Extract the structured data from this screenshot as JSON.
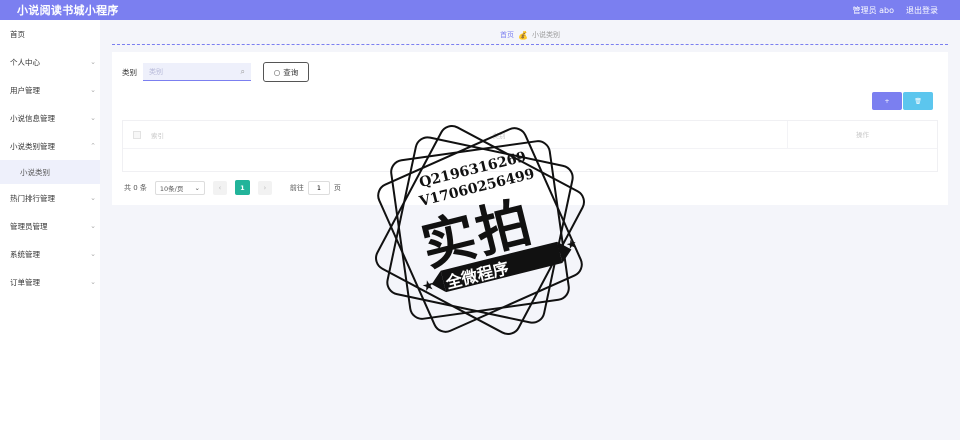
{
  "header": {
    "app_title": "小说阅读书城小程序",
    "admin_label": "管理员 abo",
    "logout_label": "退出登录"
  },
  "sidebar": {
    "items": [
      {
        "label": "首页",
        "has_arrow": false
      },
      {
        "label": "个人中心",
        "has_arrow": true
      },
      {
        "label": "用户管理",
        "has_arrow": true
      },
      {
        "label": "小说信息管理",
        "has_arrow": true
      },
      {
        "label": "小说类别管理",
        "has_arrow": true
      },
      {
        "label": "小说类别",
        "sub": true
      },
      {
        "label": "热门排行管理",
        "has_arrow": true
      },
      {
        "label": "管理员管理",
        "has_arrow": true
      },
      {
        "label": "系统管理",
        "has_arrow": true
      },
      {
        "label": "订单管理",
        "has_arrow": true
      }
    ]
  },
  "breadcrumb": {
    "home": "首页",
    "separator_icon": "moneybag-icon",
    "current": "小说类别"
  },
  "search": {
    "label": "类别",
    "placeholder": "类别",
    "query_button": "查询"
  },
  "actions": {
    "add_label": "+",
    "delete_label": "🗑"
  },
  "table": {
    "columns": [
      "索引",
      "类别",
      "操作"
    ],
    "empty_text": ""
  },
  "pagination": {
    "total_text": "共 0 条",
    "page_size": "10条/页",
    "current_page": "1",
    "goto_label": "前往",
    "goto_value": "1",
    "page_suffix": "页"
  },
  "watermark": {
    "line1": "Q2196316269",
    "line2": "V17060256499",
    "big": "实拍",
    "banner": "全微程序"
  },
  "colors": {
    "primary": "#7b7ff0",
    "info": "#5cc6ee",
    "pager_active": "#22b49a",
    "background": "#f4f5fa"
  }
}
